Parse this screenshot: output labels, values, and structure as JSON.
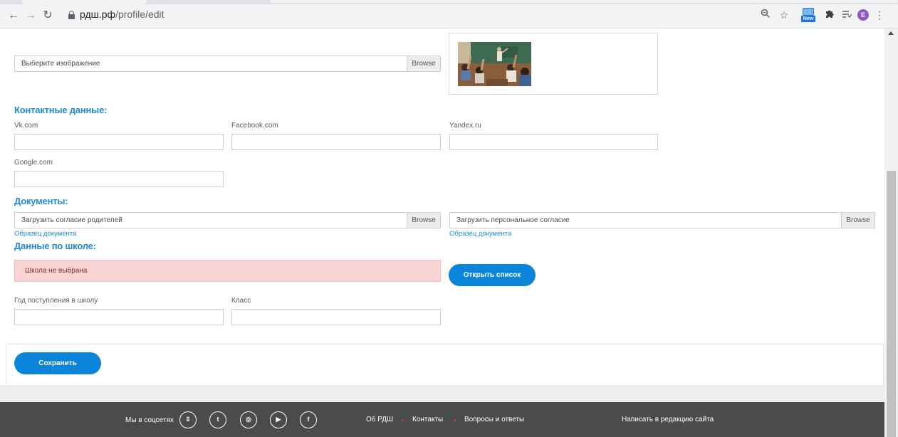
{
  "browser": {
    "url_host": "рдш.рф",
    "url_path": "/profile/edit",
    "avatar_letter": "E",
    "ext_new_label": "New"
  },
  "image_upload": {
    "placeholder": "Выберите изображение",
    "browse_label": "Browse"
  },
  "contacts": {
    "title": "Контактные данные:",
    "vk_label": "Vk.com",
    "facebook_label": "Facebook.com",
    "yandex_label": "Yandex.ru",
    "google_label": "Google.com"
  },
  "documents": {
    "title": "Документы:",
    "parents_consent_placeholder": "Загрузить согласие родителей",
    "personal_consent_placeholder": "Загрузить персональное согласие",
    "browse_label": "Browse",
    "sample_link": "Образец документа"
  },
  "school": {
    "title": "Данные по школе:",
    "not_selected": "Школа не выбрана",
    "open_list_button": "Открыть список",
    "year_label": "Год поступления в школу",
    "class_label": "Класс"
  },
  "save_button": "Сохранить",
  "footer": {
    "social_label": "Мы в соцсетях",
    "social_icons": [
      "vk-icon",
      "twitter-icon",
      "instagram-icon",
      "youtube-icon",
      "facebook-icon"
    ],
    "social_glyphs": [
      "ʬ",
      "t",
      "◎",
      "▶",
      "f"
    ],
    "links": [
      "Об РДШ",
      "Контакты",
      "Вопросы и ответы"
    ],
    "write_editor": "Написать в редакцию сайта"
  },
  "colors": {
    "accent": "#0a85d9",
    "section_title": "#1e8ad8",
    "alert_bg": "#f8d3d3",
    "footer_bg": "#4a4b4c"
  }
}
